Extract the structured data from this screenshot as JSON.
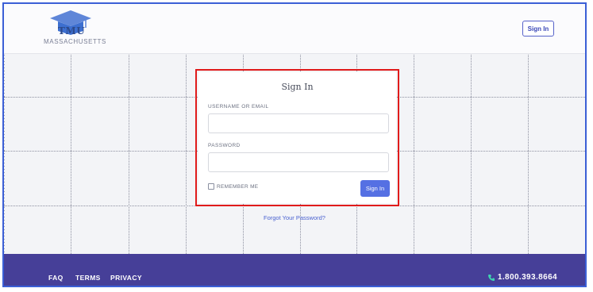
{
  "header": {
    "logo_text": "TMU",
    "logo_subtitle": "MASSACHUSETTS",
    "signin_label": "Sign In"
  },
  "login_form": {
    "title": "Sign In",
    "username_label": "USERNAME OR EMAIL",
    "username_value": "",
    "username_placeholder": "",
    "password_label": "PASSWORD",
    "password_value": "",
    "password_placeholder": "",
    "remember_label": "REMEMBER ME",
    "remember_checked": false,
    "submit_label": "Sign In"
  },
  "forgot_password_link": "Forgot Your Password?",
  "footer": {
    "links": [
      "FAQ",
      "TERMS",
      "PRIVACY"
    ],
    "phone": "1.800.393.8664"
  },
  "colors": {
    "accent": "#5570e3",
    "footer_bg": "#463f98",
    "highlight": "#e01b1b",
    "frame": "#3b5fd6"
  },
  "icons": {
    "logo": "graduation-cap-icon",
    "phone": "phone-icon"
  }
}
